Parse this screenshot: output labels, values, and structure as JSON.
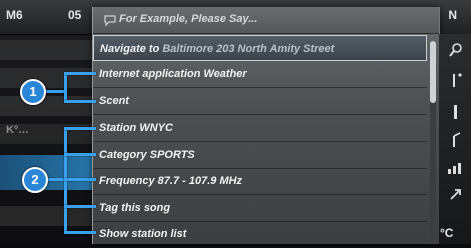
{
  "status": {
    "left": "M6",
    "time": "05",
    "right": "N"
  },
  "background": {
    "left_text": "Kº…"
  },
  "voice_help": {
    "hint_icon": "speech-bubble-icon",
    "hint_text": "For Example, Please Say...",
    "items": [
      {
        "label": "Navigate to",
        "detail": "Baltimore 203 North Amity Street"
      },
      {
        "label": "Internet application Weather",
        "detail": ""
      },
      {
        "label": "Scent",
        "detail": ""
      },
      {
        "label": "Station WNYC",
        "detail": ""
      },
      {
        "label": "Category SPORTS",
        "detail": ""
      },
      {
        "label": "Frequency 87.7 - 107.9 MHz",
        "detail": ""
      },
      {
        "label": "Tag this song",
        "detail": ""
      },
      {
        "label": "Show station list",
        "detail": ""
      }
    ]
  },
  "callouts": {
    "one": "1",
    "two": "2"
  },
  "bottom_right": "°C",
  "side_icons": [
    "search-icon",
    "antenna-icon",
    "bar-icon",
    "antenna-icon",
    "signal-icon",
    "arrow-icon"
  ],
  "colors": {
    "callout": "#2a86d6",
    "callout_line": "#39a0f0"
  }
}
